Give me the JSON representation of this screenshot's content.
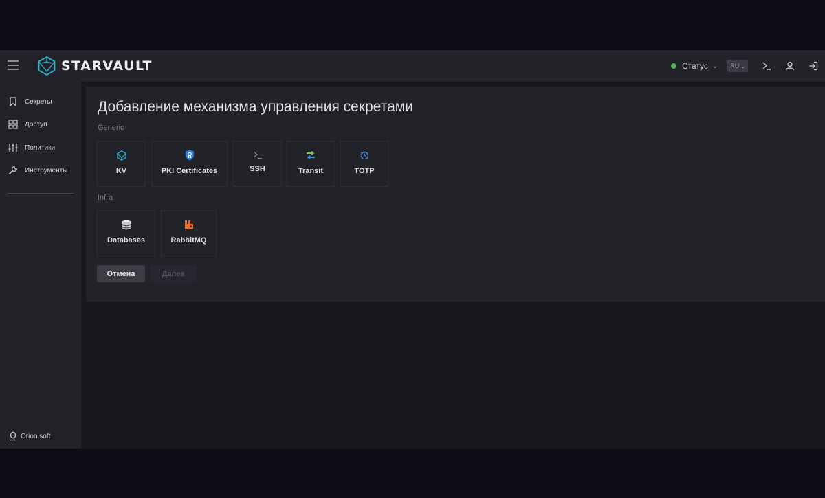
{
  "brand": {
    "name": "STARVAULT",
    "accent": "#2bb6d6"
  },
  "header": {
    "status_label": "Статус",
    "status_color": "#4caf50",
    "language": "RU",
    "icons": [
      "terminal-icon",
      "user-icon",
      "logout-icon"
    ]
  },
  "sidebar": {
    "items": [
      {
        "label": "Секреты",
        "icon": "bookmark-icon"
      },
      {
        "label": "Доступ",
        "icon": "grid-icon"
      },
      {
        "label": "Политики",
        "icon": "sliders-icon"
      },
      {
        "label": "Инструменты",
        "icon": "wrench-icon"
      }
    ],
    "org": "Orion soft"
  },
  "main": {
    "title": "Добавление механизма управления секретами",
    "sections": [
      {
        "label": "Generic",
        "engines": [
          {
            "label": "KV",
            "icon": "hexagon-icon"
          },
          {
            "label": "PKI Certificates",
            "icon": "shield-icon"
          },
          {
            "label": "SSH",
            "icon": "terminal-icon"
          },
          {
            "label": "Transit",
            "icon": "transit-icon"
          },
          {
            "label": "TOTP",
            "icon": "clock-icon"
          }
        ]
      },
      {
        "label": "Infra",
        "engines": [
          {
            "label": "Databases",
            "icon": "database-icon"
          },
          {
            "label": "RabbitMQ",
            "icon": "rabbitmq-icon"
          }
        ]
      }
    ],
    "buttons": {
      "cancel": "Отмена",
      "next": "Далее"
    }
  }
}
